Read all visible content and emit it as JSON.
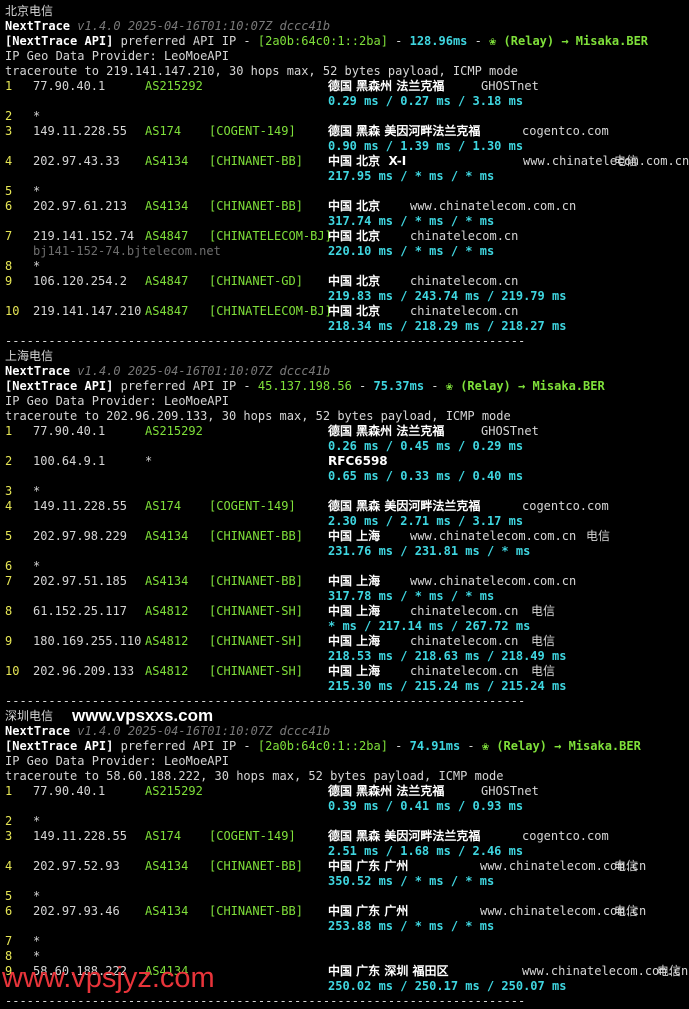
{
  "sections": [
    {
      "title": "北京电信",
      "app_name": "NextTrace",
      "version": "v1.4.0 2025-04-16T01:10:07Z dccc41b",
      "api_prefix": "[NextTrace API]",
      "api_label": " preferred API IP - ",
      "api_ip": "[2a0b:64c0:1::2ba]",
      "api_sep1": " - ",
      "api_latency": "128.96ms",
      "api_sep2": " - ",
      "api_relay": "❀ (Relay) → Misaka.BER",
      "geo_provider": "IP Geo Data Provider: LeoMoeAPI",
      "traceroute": "traceroute to 219.141.147.210, 30 hops max, 52 bytes payload, ICMP mode",
      "hops": [
        {
          "num": "1",
          "ip": "77.90.40.1",
          "asn": "AS215292",
          "tag": "",
          "geo": "德国 黑森州 法兰克福",
          "org": "GHOSTnet",
          "isp": "",
          "rtt": "0.29 ms / 0.27 ms / 3.18 ms",
          "ptr": ""
        },
        {
          "num": "2",
          "ip": "*",
          "asn": "",
          "tag": "",
          "geo": "",
          "org": "",
          "isp": "",
          "rtt": "",
          "ptr": ""
        },
        {
          "num": "3",
          "ip": "149.11.228.55",
          "asn": "AS174",
          "tag": "[COGENT-149]",
          "geo": "德国 黑森 美因河畔法兰克福",
          "org": "cogentco.com",
          "isp": "",
          "rtt": "0.90 ms / 1.39 ms / 1.30 ms",
          "ptr": ""
        },
        {
          "num": "4",
          "ip": "202.97.43.33",
          "asn": "AS4134",
          "tag": "[CHINANET-BB]",
          "geo": "中国 北京  X-I",
          "org": "www.chinatelecom.com.cn",
          "isp": "电信",
          "rtt": "217.95 ms / * ms / * ms",
          "ptr": ""
        },
        {
          "num": "5",
          "ip": "*",
          "asn": "",
          "tag": "",
          "geo": "",
          "org": "",
          "isp": "",
          "rtt": "",
          "ptr": ""
        },
        {
          "num": "6",
          "ip": "202.97.61.213",
          "asn": "AS4134",
          "tag": "[CHINANET-BB]",
          "geo": "中国 北京",
          "org": "www.chinatelecom.com.cn",
          "isp": "",
          "rtt": "317.74 ms / * ms / * ms",
          "ptr": ""
        },
        {
          "num": "7",
          "ip": "219.141.152.74",
          "asn": "AS4847",
          "tag": "[CHINATELECOM-BJ]",
          "geo": "中国 北京",
          "org": "chinatelecom.cn",
          "isp": "",
          "rtt": "220.10 ms / * ms / * ms",
          "ptr": "bj141-152-74.bjtelecom.net"
        },
        {
          "num": "8",
          "ip": "*",
          "asn": "",
          "tag": "",
          "geo": "",
          "org": "",
          "isp": "",
          "rtt": "",
          "ptr": ""
        },
        {
          "num": "9",
          "ip": "106.120.254.2",
          "asn": "AS4847",
          "tag": "[CHINANET-GD]",
          "geo": "中国 北京",
          "org": "chinatelecom.cn",
          "isp": "",
          "rtt": "219.83 ms / 243.74 ms / 219.79 ms",
          "ptr": ""
        },
        {
          "num": "10",
          "ip": "219.141.147.210",
          "asn": "AS4847",
          "tag": "[CHINATELECOM-BJ]",
          "geo": "中国 北京",
          "org": "chinatelecom.cn",
          "isp": "",
          "rtt": "218.34 ms / 218.29 ms / 218.27 ms",
          "ptr": ""
        }
      ]
    },
    {
      "title": "上海电信",
      "app_name": "NextTrace",
      "version": "v1.4.0 2025-04-16T01:10:07Z dccc41b",
      "api_prefix": "[NextTrace API]",
      "api_label": " preferred API IP - ",
      "api_ip": "45.137.198.56",
      "api_sep1": " - ",
      "api_latency": "75.37ms",
      "api_sep2": " - ",
      "api_relay": "❀ (Relay) → Misaka.BER",
      "geo_provider": "IP Geo Data Provider: LeoMoeAPI",
      "traceroute": "traceroute to 202.96.209.133, 30 hops max, 52 bytes payload, ICMP mode",
      "hops": [
        {
          "num": "1",
          "ip": "77.90.40.1",
          "asn": "AS215292",
          "tag": "",
          "geo": "德国 黑森州 法兰克福",
          "org": "GHOSTnet",
          "isp": "",
          "rtt": "0.26 ms / 0.45 ms / 0.29 ms",
          "ptr": ""
        },
        {
          "num": "2",
          "ip": "100.64.9.1",
          "asn": "*",
          "tag": "",
          "geo": "RFC6598",
          "org": "",
          "isp": "",
          "rtt": "0.65 ms / 0.33 ms / 0.40 ms",
          "ptr": ""
        },
        {
          "num": "3",
          "ip": "*",
          "asn": "",
          "tag": "",
          "geo": "",
          "org": "",
          "isp": "",
          "rtt": "",
          "ptr": ""
        },
        {
          "num": "4",
          "ip": "149.11.228.55",
          "asn": "AS174",
          "tag": "[COGENT-149]",
          "geo": "德国 黑森 美因河畔法兰克福",
          "org": "cogentco.com",
          "isp": "",
          "rtt": "2.30 ms / 2.71 ms / 3.17 ms",
          "ptr": ""
        },
        {
          "num": "5",
          "ip": "202.97.98.229",
          "asn": "AS4134",
          "tag": "[CHINANET-BB]",
          "geo": "中国 上海",
          "org": "www.chinatelecom.com.cn",
          "isp": "电信",
          "rtt": "231.76 ms / 231.81 ms / * ms",
          "ptr": ""
        },
        {
          "num": "6",
          "ip": "*",
          "asn": "",
          "tag": "",
          "geo": "",
          "org": "",
          "isp": "",
          "rtt": "",
          "ptr": ""
        },
        {
          "num": "7",
          "ip": "202.97.51.185",
          "asn": "AS4134",
          "tag": "[CHINANET-BB]",
          "geo": "中国 上海",
          "org": "www.chinatelecom.com.cn",
          "isp": "",
          "rtt": "317.78 ms / * ms / * ms",
          "ptr": ""
        },
        {
          "num": "8",
          "ip": "61.152.25.117",
          "asn": "AS4812",
          "tag": "[CHINANET-SH]",
          "geo": "中国 上海",
          "org": "chinatelecom.cn",
          "isp": "电信",
          "rtt": "* ms / 217.14 ms / 267.72 ms",
          "ptr": ""
        },
        {
          "num": "9",
          "ip": "180.169.255.110",
          "asn": "AS4812",
          "tag": "[CHINANET-SH]",
          "geo": "中国 上海",
          "org": "chinatelecom.cn",
          "isp": "电信",
          "rtt": "218.53 ms / 218.63 ms / 218.49 ms",
          "ptr": ""
        },
        {
          "num": "10",
          "ip": "202.96.209.133",
          "asn": "AS4812",
          "tag": "[CHINANET-SH]",
          "geo": "中国 上海",
          "org": "chinatelecom.cn",
          "isp": "电信",
          "rtt": "215.30 ms / 215.24 ms / 215.24 ms",
          "ptr": ""
        }
      ]
    },
    {
      "title": "深圳电信",
      "app_name": "NextTrace",
      "version": "v1.4.0 2025-04-16T01:10:07Z dccc41b",
      "api_prefix": "[NextTrace API]",
      "api_label": " preferred API IP - ",
      "api_ip": "[2a0b:64c0:1::2ba]",
      "api_sep1": " - ",
      "api_latency": "74.91ms",
      "api_sep2": " - ",
      "api_relay": "❀ (Relay) → Misaka.BER",
      "geo_provider": "IP Geo Data Provider: LeoMoeAPI",
      "traceroute": "traceroute to 58.60.188.222, 30 hops max, 52 bytes payload, ICMP mode",
      "hops": [
        {
          "num": "1",
          "ip": "77.90.40.1",
          "asn": "AS215292",
          "tag": "",
          "geo": "德国 黑森州 法兰克福",
          "org": "GHOSTnet",
          "isp": "",
          "rtt": "0.39 ms / 0.41 ms / 0.93 ms",
          "ptr": ""
        },
        {
          "num": "2",
          "ip": "*",
          "asn": "",
          "tag": "",
          "geo": "",
          "org": "",
          "isp": "",
          "rtt": "",
          "ptr": ""
        },
        {
          "num": "3",
          "ip": "149.11.228.55",
          "asn": "AS174",
          "tag": "[COGENT-149]",
          "geo": "德国 黑森 美因河畔法兰克福",
          "org": "cogentco.com",
          "isp": "",
          "rtt": "2.51 ms / 1.68 ms / 2.46 ms",
          "ptr": ""
        },
        {
          "num": "4",
          "ip": "202.97.52.93",
          "asn": "AS4134",
          "tag": "[CHINANET-BB]",
          "geo": "中国 广东 广州",
          "org": "www.chinatelecom.com.cn",
          "isp": "电信",
          "rtt": "350.52 ms / * ms / * ms",
          "ptr": ""
        },
        {
          "num": "5",
          "ip": "*",
          "asn": "",
          "tag": "",
          "geo": "",
          "org": "",
          "isp": "",
          "rtt": "",
          "ptr": ""
        },
        {
          "num": "6",
          "ip": "202.97.93.46",
          "asn": "AS4134",
          "tag": "[CHINANET-BB]",
          "geo": "中国 广东 广州",
          "org": "www.chinatelecom.com.cn",
          "isp": "电信",
          "rtt": "253.88 ms / * ms / * ms",
          "ptr": ""
        },
        {
          "num": "7",
          "ip": "*",
          "asn": "",
          "tag": "",
          "geo": "",
          "org": "",
          "isp": "",
          "rtt": "",
          "ptr": ""
        },
        {
          "num": "8",
          "ip": "*",
          "asn": "",
          "tag": "",
          "geo": "",
          "org": "",
          "isp": "",
          "rtt": "",
          "ptr": ""
        },
        {
          "num": "9",
          "ip": "58.60.188.222",
          "asn": "AS4134",
          "tag": "",
          "geo": "中国 广东 深圳 福田区",
          "org": "www.chinatelecom.com.cn",
          "isp": "电信",
          "rtt": "250.02 ms / 250.17 ms / 250.07 ms",
          "ptr": ""
        }
      ]
    }
  ],
  "separator": "------------------------------------------------------------------------",
  "watermark_top": "www.vpsxxs.com",
  "watermark_bottom": "www.vpsjyz.com",
  "colors": {
    "background": "#000000",
    "text": "#d6d6d6",
    "green": "#7fe03a",
    "yellow": "#e6e655",
    "cyan": "#3fd6e0",
    "dim": "#6e6e6e",
    "watermark_red": "#e8343a"
  }
}
